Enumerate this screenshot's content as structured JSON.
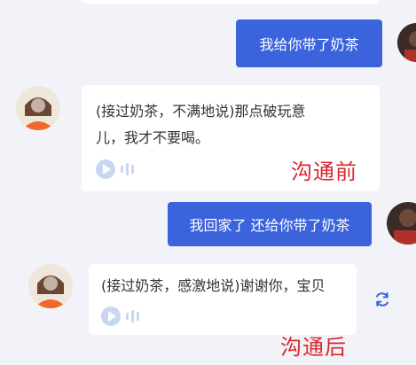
{
  "conversation_1": {
    "user_message": "我给你带了奶茶",
    "reply_action": "(接过奶茶，不满地说)",
    "reply_text": "那点破玩意儿，我才不要喝。",
    "caption": "沟通前"
  },
  "conversation_2": {
    "user_message": "我回家了 还给你带了奶茶",
    "reply_action": "(接过奶茶，感激地说)",
    "reply_text": "谢谢你，宝贝",
    "caption": "沟通后"
  },
  "icons": {
    "play": "play-icon",
    "waveform": "voice-wave-icon",
    "regenerate": "refresh-icon",
    "avatar_ai": "avatar",
    "avatar_user": "avatar"
  },
  "colors": {
    "user_bubble": "#3a63dc",
    "caption": "#d9282f",
    "background": "#f2f3f8",
    "voice_icon": "#c9d6f3"
  }
}
